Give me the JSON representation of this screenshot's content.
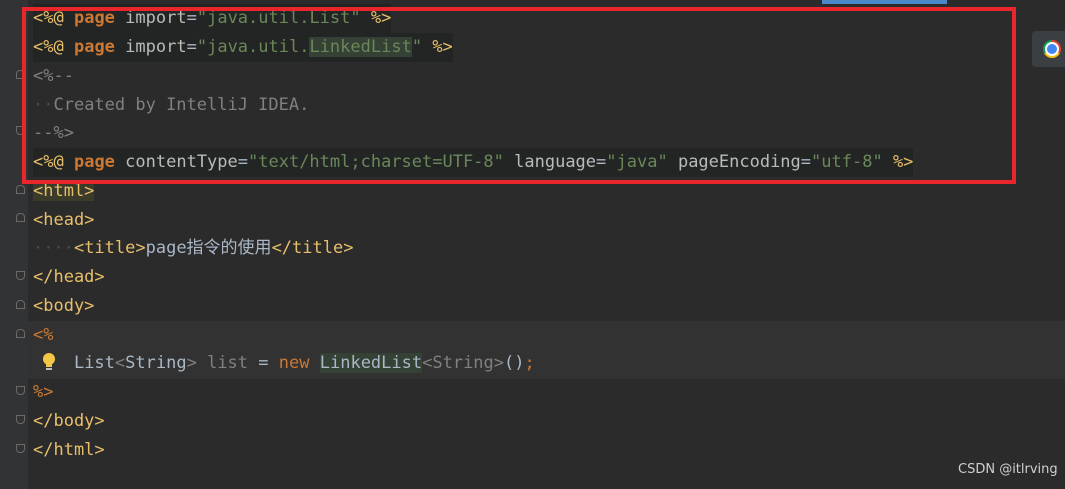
{
  "editor": {
    "line1": {
      "open": "<%@",
      "directive": "page",
      "attr": "import",
      "eq": "=",
      "quote_open": "\"",
      "value": "java.util.List",
      "quote_close": "\"",
      "close": "%>"
    },
    "line2": {
      "open": "<%@",
      "directive": "page",
      "attr": "import",
      "eq": "=",
      "quote_open": "\"",
      "value_prefix": "java.util.",
      "value_highlight": "LinkedList",
      "quote_close": "\"",
      "close": "%>"
    },
    "line3": "<%--",
    "line4": "Created by IntelliJ IDEA.",
    "line5": "--%>",
    "line6": {
      "open": "<%@",
      "directive": "page",
      "attr1": "contentType",
      "val1": "\"text/html;charset=UTF-8\"",
      "attr2": "language",
      "val2": "\"java\"",
      "attr3": "pageEncoding",
      "val3": "\"utf-8\"",
      "close": "%>"
    },
    "line7": "<html>",
    "line8": "<head>",
    "line9": {
      "open_tag": "<title>",
      "text": "page指令的使用",
      "close_tag": "</title>"
    },
    "line10": "</head>",
    "line11": "<body>",
    "line12": "<%",
    "line13": {
      "type1": "List",
      "lt1": "<",
      "type2": "String",
      "gt1": ">",
      "var": "list",
      "eq": "=",
      "kw_new": "new",
      "type3": "LinkedList",
      "lt2": "<",
      "type4": "String",
      "gt2": ">",
      "parens": "()",
      "semi": ";"
    },
    "line14": "%>",
    "line15": "</body>",
    "line16": "</html>"
  },
  "watermark": "CSDN @itlrving",
  "icons": {
    "browser": "chrome-icon",
    "intention": "lightbulb-icon"
  },
  "colors": {
    "background": "#2b2b2b",
    "highlight_box": "#e8262b",
    "tag": "#e8bf6a",
    "keyword": "#cc7832",
    "string": "#6a8759",
    "comment": "#808080"
  }
}
